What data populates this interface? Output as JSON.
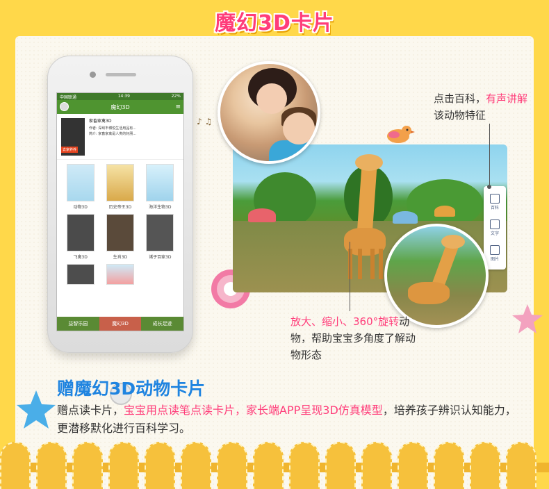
{
  "banner": {
    "title": "魔幻3D卡片"
  },
  "phone": {
    "status_left": "中国联通",
    "status_time": "14:39",
    "status_right": "22%",
    "app_title": "魔幻3D",
    "featured": {
      "title": "家畜家禽3D",
      "line1": "作者: 深圳市博悦生活用品有...",
      "line2": "简介: 家畜家禽是人类的好朋...",
      "tag": "去家养养"
    },
    "grid": [
      {
        "label": "动物3D"
      },
      {
        "label": "历史帝王3D"
      },
      {
        "label": "海洋生物3D"
      },
      {
        "label": "飞禽3D"
      },
      {
        "label": "生肖3D"
      },
      {
        "label": "诸子百家3D"
      },
      {
        "label": ""
      },
      {
        "label": ""
      },
      {
        "label": ""
      }
    ],
    "tabs": [
      {
        "label": "益智乐园"
      },
      {
        "label": "魔幻3D"
      },
      {
        "label": "成长足迹"
      }
    ]
  },
  "side_tools": [
    {
      "label": "百科",
      "icon": "encyclopedia-icon"
    },
    {
      "label": "文字",
      "icon": "text-icon"
    },
    {
      "label": "图片",
      "icon": "image-icon"
    }
  ],
  "callout_top": {
    "part1": "点击百科，",
    "part2_pink": "有声讲解",
    "part3": "该动物特征"
  },
  "callout_bottom": {
    "part1_pink": "放大、缩小、360°旋转",
    "part2": "动物，帮助宝宝多角度了解动物形态"
  },
  "section": {
    "title": "赠魔幻3D动物卡片",
    "body_part1": "赠点读卡片，",
    "body_part2_pink": "宝宝用点读笔点读卡片，家长端APP呈现3D仿真模型",
    "body_part3": "，培养孩子辨识认知能力，更潜移默化进行百科学习。"
  },
  "colors": {
    "accent_pink": "#ff3d7a",
    "title_blue": "#1f84e0",
    "background_yellow": "#ffd84a"
  }
}
